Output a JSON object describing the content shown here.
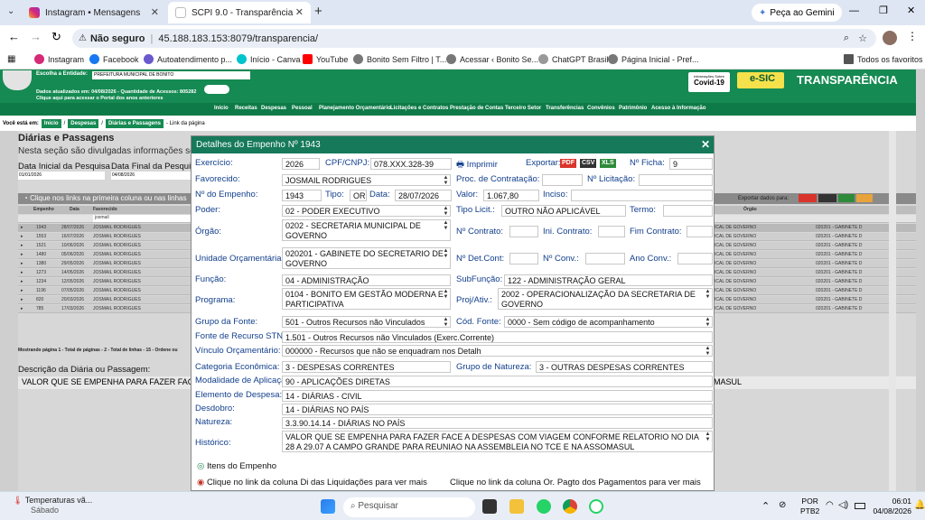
{
  "browser": {
    "tabs": [
      {
        "label": "Instagram • Mensagens"
      },
      {
        "label": "SCPI 9.0 - Transparência"
      }
    ],
    "new_tab": "+",
    "gemini_button": "Peça ao Gemini",
    "security": "Não seguro",
    "url": "45.188.183.153:8079/transparencia/",
    "bookmarks": [
      "Instagram",
      "Facebook",
      "Autoatendimento p...",
      "Início - Canva",
      "YouTube",
      "Bonito Sem Filtro | T...",
      "Acessar ‹ Bonito Se...",
      "ChatGPT Brasil",
      "Página Inicial - Pref...",
      "Todos os favoritos"
    ]
  },
  "site": {
    "entity_label": "Escolha a Entidade:",
    "entity_value": "PREFEITURA MUNICIPAL DE BONITO",
    "updated_info": "Dados atualizados em: 04/08/2026 - Quantidade de Acessos: 805282",
    "portal_info": "Clique aqui para acessar o Portal dos anos anteriores",
    "covid_badge_top": "Informações Sobre",
    "covid_badge": "Covid-19",
    "esic": "e-SIC",
    "brand": "TRANSPARÊNCIA",
    "nav": [
      "Início",
      "Receitas",
      "Despesas",
      "Pessoal",
      "Planejamento Orçamentário",
      "Licitações e Contratos",
      "Prestação de Contas",
      "Terceiro Setor",
      "Transferências",
      "Convênios",
      "Patrimônio",
      "Acesso à Informação"
    ],
    "breadcrumb_label": "Você está em:",
    "breadcrumb": [
      "Início",
      "Despesas",
      "Diárias e Passagens"
    ],
    "breadcrumb_tail": "- Link da página",
    "page_title": "Diárias e Passagens",
    "page_desc": "Nesta seção são divulgadas informações sobre as",
    "date_start_label": "Data Inicial da Pesquisa",
    "date_start": "01/01/2026",
    "date_end_label": "Data Final da Pesquisa",
    "date_end": "04/08/2026",
    "grid_hint": "Clique nos links na primeira coluna ou nas linhas",
    "export_label": "Exportar dados para:",
    "grid_cols": [
      "Empenho",
      "Data",
      "Favorecido",
      "Órgão"
    ],
    "grid_filter": "josmail",
    "grid_rows": [
      [
        "1943",
        "28/07/2026",
        "JOSMAIL RODRIGUES",
        "020201 - GABINETE D"
      ],
      [
        "1553",
        "16/07/2026",
        "JOSMAIL RODRIGUES",
        "020201 - GABINETE D"
      ],
      [
        "1521",
        "10/06/2026",
        "JOSMAIL RODRIGUES",
        "020201 - GABINETE D"
      ],
      [
        "1480",
        "05/06/2026",
        "JOSMAIL RODRIGUES",
        "020201 - GABINETE D"
      ],
      [
        "1380",
        "29/05/2026",
        "JOSMAIL RODRIGUES",
        "020201 - GABINETE D"
      ],
      [
        "1273",
        "14/05/2026",
        "JOSMAIL RODRIGUES",
        "020201 - GABINETE D"
      ],
      [
        "1234",
        "12/05/2026",
        "JOSMAIL RODRIGUES",
        "020201 - GABINETE D"
      ],
      [
        "1196",
        "07/05/2026",
        "JOSMAIL RODRIGUES",
        "020201 - GABINETE D"
      ],
      [
        "820",
        "20/03/2026",
        "JOSMAIL RODRIGUES",
        "020201 - GABINETE D"
      ],
      [
        "785",
        "17/03/2026",
        "JOSMAIL RODRIGUES",
        "020201 - GABINETE D"
      ]
    ],
    "grid_orgao_tail": "ICAL DE GOVERNO",
    "grid_footer": "Mostrando página 1 - Total de páginas - 2 - Total de linhas - 15 - Ordene ou",
    "desc_label": "Descrição da Diária ou Passagem:",
    "desc_text": "VALOR QUE SE EMPENHA PARA FAZER FACE A",
    "desc_tail": "MASUL"
  },
  "modal": {
    "title": "Detalhes do Empenho Nº 1943",
    "exercicio_label": "Exercício:",
    "exercicio": "2026",
    "cpf_label": "CPF/CNPJ:",
    "cpf": "078.XXX.328-39",
    "print_label": "Imprimir",
    "export_label": "Exportar:",
    "ficha_label": "Nº Ficha:",
    "ficha": "9",
    "favorecido_label": "Favorecido:",
    "favorecido": "JOSMAIL RODRIGUES",
    "proc_label": "Proc. de Contratação:",
    "proc": "",
    "licit_label": "Nº Licitação:",
    "licit": "",
    "empenho_label": "Nº do Empenho:",
    "empenho": "1943",
    "tipo_label": "Tipo:",
    "tipo": "OR",
    "data_label": "Data:",
    "data": "28/07/2026",
    "valor_label": "Valor:",
    "valor": "1.067,80",
    "inciso_label": "Inciso:",
    "inciso": "",
    "poder_label": "Poder:",
    "poder": "02 - PODER EXECUTIVO",
    "tipolicit_label": "Tipo Licit.:",
    "tipolicit": "OUTRO NÃO APLICÁVEL",
    "termo_label": "Termo:",
    "termo": "",
    "orgao_label": "Órgão:",
    "orgao": "0202 - SECRETARIA MUNICIPAL DE GOVERNO",
    "ncontrato_label": "Nº Contrato:",
    "ncontrato": "",
    "inicontrato_label": "Ini. Contrato:",
    "inicontrato": "",
    "fimcontrato_label": "Fim Contrato:",
    "fimcontrato": "",
    "unidade_label": "Unidade Orçamentária:",
    "unidade": "020201 - GABINETE DO SECRETARIO DE GOVERNO",
    "ndetcont_label": "Nº Det.Cont:",
    "ndetcont": "",
    "nconv_label": "Nº Conv.:",
    "nconv": "",
    "anoconv_label": "Ano Conv.:",
    "anoconv": "",
    "funcao_label": "Função:",
    "funcao": "04 - ADMINISTRAÇÃO",
    "subfuncao_label": "SubFunção:",
    "subfuncao": "122 - ADMINISTRAÇÃO GERAL",
    "programa_label": "Programa:",
    "programa": "0104 - BONITO EM GESTÃO MODERNA E PARTICIPATIVA",
    "projativ_label": "Proj/Ativ.:",
    "projativ": "2002 - OPERACIONALIZAÇÃO DA SECRETARIA DE GOVERNO",
    "grupofonte_label": "Grupo da Fonte:",
    "grupofonte": "501 - Outros Recursos não Vinculados",
    "codfonte_label": "Cód. Fonte:",
    "codfonte": "0000 - Sem código de acompanhamento",
    "fontestn_label": "Fonte de Recurso STN:",
    "fontestn": "1.501 - Outros Recursos não Vinculados (Exerc.Corrente)",
    "vinculo_label": "Vínculo Orçamentário:",
    "vinculo": "000000 - Recursos que não se enquadram nos Detalh",
    "categoria_label": "Categoria Econômica:",
    "categoria": "3 - DESPESAS CORRENTES",
    "gruponat_label": "Grupo de Natureza:",
    "gruponat": "3 - OUTRAS DESPESAS CORRENTES",
    "modalidade_label": "Modalidade de Aplicação:",
    "modalidade": "90 - APLICAÇÕES DIRETAS",
    "elemento_label": "Elemento de Despesa:",
    "elemento": "14 - DIÁRIAS - CIVIL",
    "desdobro_label": "Desdobro:",
    "desdobro": "14 - DIÁRIAS NO PAÍS",
    "natureza_label": "Natureza:",
    "natureza": "3.3.90.14.14 - DIÁRIAS NO PAÍS",
    "historico_label": "Histórico:",
    "historico": "VALOR QUE SE EMPENHA PARA FAZER FACE A DESPESAS COM VIAGEM CONFORME RELATORIO NO DIA 28 A 29.07 A CAMPO GRANDE PARA REUNIAO NA ASSEMBLEIA NO TCE E NA ASSOMASUL",
    "itens_label": "Itens do Empenho",
    "liquid_hint": "Clique no link da coluna Di das Liquidações para ver mais",
    "pagto_hint": "Clique no link da coluna Or. Pagto dos Pagamentos para ver mais"
  },
  "taskbar": {
    "weather_title": "Temperaturas vã...",
    "weather_sub": "Sábado",
    "search_placeholder": "Pesquisar",
    "lang1": "POR",
    "lang2": "PTB2",
    "time": "06:01",
    "date": "04/08/2026"
  },
  "colors": {
    "header_green": "#158a52",
    "modal_title": "#15795a",
    "label_blue": "#123f8c"
  }
}
